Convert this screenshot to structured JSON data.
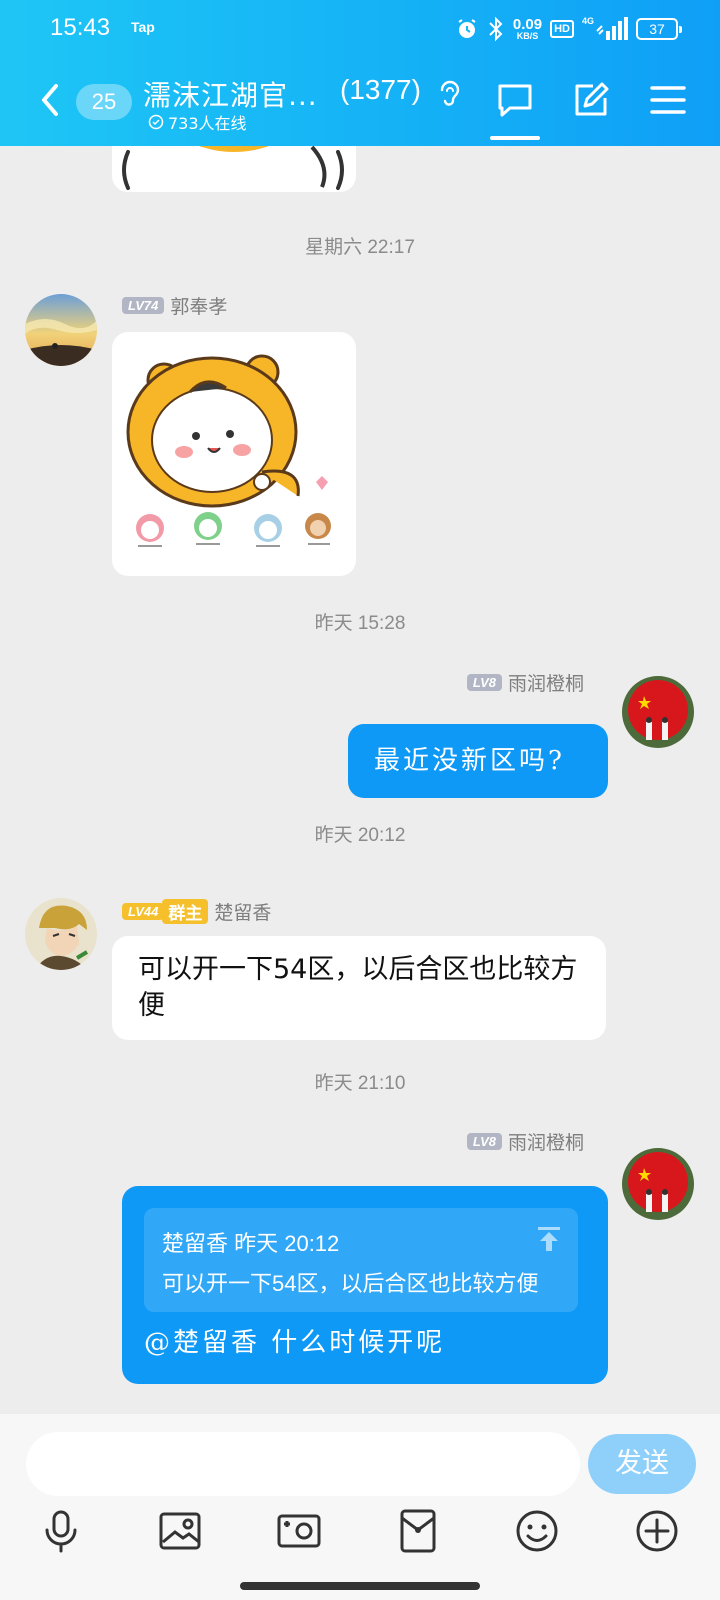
{
  "status_bar": {
    "time": "15:43",
    "app_tag": "Tap",
    "net_speed": "0.09",
    "net_unit": "KB/S",
    "hd": "HD",
    "signal": "4G",
    "battery": "37"
  },
  "header": {
    "unread": "25",
    "group_name": "濡沫江湖官...",
    "member_count": "(1377)",
    "online": "733人在线"
  },
  "messages": [
    {
      "time": "星期六 22:17",
      "sender": "郭奉孝",
      "level": "LV74",
      "type": "sticker"
    },
    {
      "time": "昨天 15:28",
      "sender": "雨润橙桐",
      "level": "LV8",
      "text": "最近没新区吗?"
    },
    {
      "time": "昨天 20:12",
      "sender": "楚留香",
      "level": "LV44",
      "badge": "群主",
      "text": "可以开一下54区，以后合区也比较方便"
    },
    {
      "time": "昨天 21:10",
      "sender": "雨润橙桐",
      "level": "LV8",
      "quote": {
        "header": "楚留香 昨天 20:12",
        "text": "可以开一下54区，以后合区也比较方便"
      },
      "text": "@楚留香 什么时候开呢"
    }
  ],
  "input": {
    "placeholder": "",
    "send_label": "发送"
  },
  "colors": {
    "header_start": "#1ec6f5",
    "header_end": "#0f9ff7",
    "bubble_out": "#0f99f6",
    "level_gold": "#f5c02b"
  }
}
